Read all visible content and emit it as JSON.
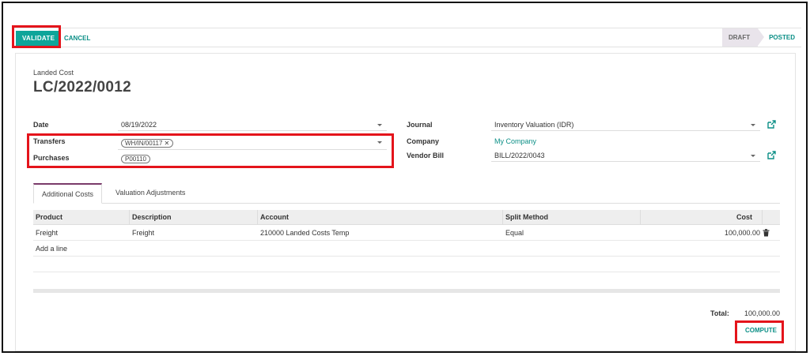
{
  "control": {
    "validate_label": "VALIDATE",
    "cancel_label": "CANCEL",
    "states": [
      "DRAFT",
      "POSTED"
    ]
  },
  "record": {
    "model_label": "Landed Cost",
    "name": "LC/2022/0012"
  },
  "fields": {
    "date_label": "Date",
    "date_value": "08/19/2022",
    "transfers_label": "Transfers",
    "transfers_tag": "WH/IN/00117",
    "purchases_label": "Purchases",
    "purchases_tag": "P00110",
    "journal_label": "Journal",
    "journal_value": "Inventory Valuation (IDR)",
    "company_label": "Company",
    "company_value": "My Company",
    "vendor_bill_label": "Vendor Bill",
    "vendor_bill_value": "BILL/2022/0043"
  },
  "tabs": [
    "Additional Costs",
    "Valuation Adjustments"
  ],
  "table": {
    "headers": [
      "Product",
      "Description",
      "Account",
      "Split Method",
      "Cost"
    ],
    "rows": [
      [
        "Freight",
        "Freight",
        "210000 Landed Costs Temp",
        "Equal",
        "100,000.00"
      ]
    ],
    "add_line": "Add a line"
  },
  "totals": {
    "label": "Total:",
    "value": "100,000.00"
  },
  "compute_label": "COMPUTE",
  "colors": {
    "primary": "#0ea59a",
    "link": "#0b8f86",
    "highlight": "#e4141b",
    "tab_accent": "#7a3a6a"
  }
}
